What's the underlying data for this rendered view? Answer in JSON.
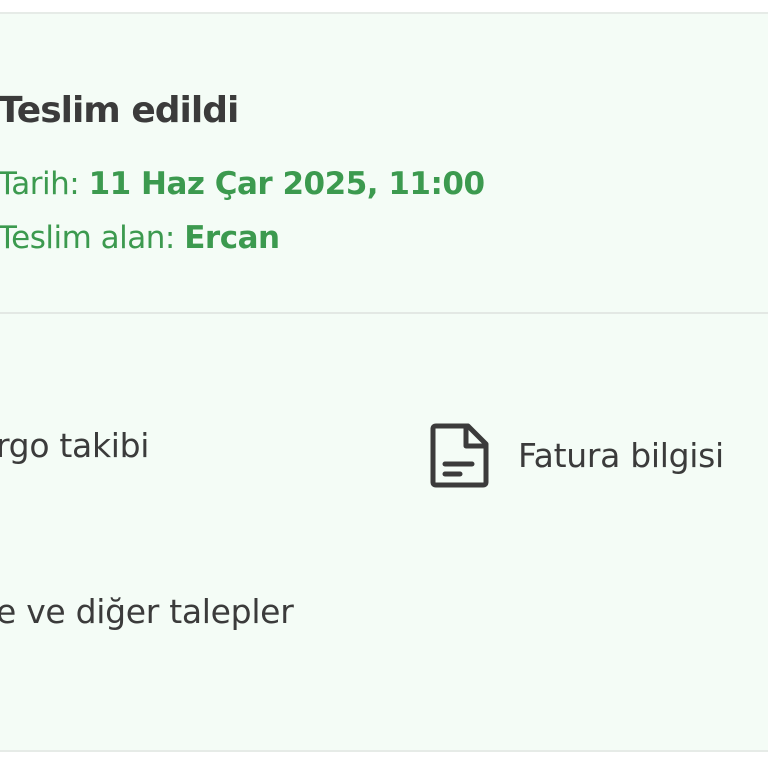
{
  "status": {
    "title": "Teslim edildi",
    "date_label": "Tarih: ",
    "date_value": "11 Haz Çar 2025, 11:00",
    "receiver_label": "Teslim alan: ",
    "receiver_value": "Ercan"
  },
  "actions": {
    "cargo_tracking": "rgo takibi",
    "invoice": "Fatura bilgisi",
    "invoice_icon": "document-icon",
    "returns": "e ve diğer talepler"
  },
  "colors": {
    "accent_green": "#3c9a4f",
    "card_background": "#f4fcf6",
    "text_dark": "#3b3b3b"
  }
}
